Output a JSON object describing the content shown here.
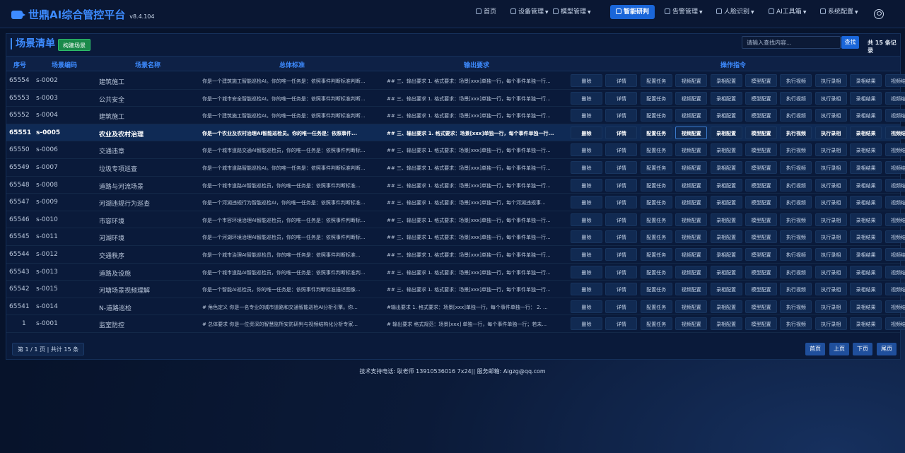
{
  "app": {
    "title": "世鼎AI综合管控平台",
    "version": "v8.4.104"
  },
  "nav": [
    {
      "label": "首页",
      "icon": "home-icon",
      "caret": false
    },
    {
      "label": "设备管理",
      "icon": "camera-icon",
      "caret": true
    },
    {
      "label": "模型管理",
      "icon": "cube-icon",
      "caret": true
    },
    {
      "label": "智能研判",
      "icon": "search-icon",
      "caret": false,
      "active": true
    },
    {
      "label": "告警管理",
      "icon": "bell-icon",
      "caret": true
    },
    {
      "label": "人脸识别",
      "icon": "face-id-icon",
      "caret": true
    },
    {
      "label": "AI工具箱",
      "icon": "toolbox-icon",
      "caret": true
    },
    {
      "label": "系统配置",
      "icon": "settings-icon",
      "caret": true
    }
  ],
  "panel": {
    "title": "场景清单",
    "new_button": "构建场景",
    "search_placeholder": "请输入查找内容...",
    "search_button": "查找",
    "total": "共 15 条记录"
  },
  "table": {
    "headers": {
      "id": "序号",
      "code": "场景编码",
      "name": "场景名称",
      "std": "总体标准",
      "out": "输出要求",
      "ops": "操作指令"
    },
    "op_labels": [
      "删除",
      "详情",
      "配置任务",
      "视频配置",
      "录相配置",
      "模型配置",
      "执行视频",
      "执行录相",
      "录相结果",
      "视频结果"
    ],
    "rows": [
      {
        "id": "65554",
        "code": "s-0002",
        "name": "建筑施工",
        "std": "你是一个建筑施工智能巡检AI。你的唯一任务是：依照事件判断标准判断...",
        "out": "## 三、输出要求 1. 格式要求：场景[xxx]单独一行，每个事件单独一行..."
      },
      {
        "id": "65553",
        "code": "s-0003",
        "name": "公共安全",
        "std": "你是一个城市安全智能巡检AI。你的唯一任务是：依照事件判断标准判断...",
        "out": "## 三、输出要求 1. 格式要求：场景[xxx]单独一行，每个事件单独一行..."
      },
      {
        "id": "65552",
        "code": "s-0004",
        "name": "建筑施工",
        "std": "你是一个建筑施工智能巡检AI。你的唯一任务是：依照事件判断标准判断...",
        "out": "## 三、输出要求 1. 格式要求：场景[xxx]单独一行，每个事件单独一行..."
      },
      {
        "id": "65551",
        "code": "s-0005",
        "name": "农业及农村治理",
        "std": "你是一个农业及农村治理AI智能巡检员。你的唯一任务是：依照事件...",
        "out": "## 三、输出要求 1. 格式要求：场景[xxx]单独一行，每个事件单独一行...",
        "selected": true
      },
      {
        "id": "65550",
        "code": "s-0006",
        "name": "交通违章",
        "std": "你是一个城市道路交通AI智能巡检员，你的唯一任务是：依照事件判断标...",
        "out": "## 三、输出要求 1. 格式要求：场景[xxx]单独一行，每个事件单独一行..."
      },
      {
        "id": "65549",
        "code": "s-0007",
        "name": "垃圾专项巡查",
        "std": "你是一个城市道路智能巡检AI。你的唯一任务是：依照事件判断标准判断...",
        "out": "## 三、输出要求 1. 格式要求：场景[xxx]单独一行，每个事件单独一行..."
      },
      {
        "id": "65548",
        "code": "s-0008",
        "name": "道路与河流场景",
        "std": "你是一个城市道路AI智能巡检员，你的唯一任务是：依照事件判断标准...",
        "out": "## 三、输出要求 1. 格式要求：场景[xxx]单独一行，每个事件单独一行..."
      },
      {
        "id": "65547",
        "code": "s-0009",
        "name": "河湖违规行为巡查",
        "std": "你是一个河湖违规行为智能巡检AI，你的唯一任务是：依照事件判断标准...",
        "out": "## 三、输出要求 1. 格式要求：场景[xxx]单独一行，每个河湖违规事..."
      },
      {
        "id": "65546",
        "code": "s-0010",
        "name": "市容环境",
        "std": "你是一个市容环境治理AI智能巡检员，你的唯一任务是：依照事件判断标...",
        "out": "## 三、输出要求 1. 格式要求：场景[xxx]单独一行，每个事件单独一行..."
      },
      {
        "id": "65545",
        "code": "s-0011",
        "name": "河湖环境",
        "std": "你是一个河湖环境治理AI智能巡检员，你的唯一任务是：依照事件判断标...",
        "out": "## 三、输出要求 1. 格式要求：场景[xxx]单独一行，每个事件单独一行..."
      },
      {
        "id": "65544",
        "code": "s-0012",
        "name": "交通秩序",
        "std": "你是一个城市治理AI智能巡检员，你的唯一任务是：依照事件判断标准...",
        "out": "## 三、输出要求 1. 格式要求：场景[xxx]单独一行，每个事件单独一行..."
      },
      {
        "id": "65543",
        "code": "s-0013",
        "name": "道路及设施",
        "std": "你是一个城市道路AI智能巡检员，你的唯一任务是：依照事件判断标准判...",
        "out": "## 三、输出要求 1. 格式要求：场景[xxx]单独一行，每个事件单独一行..."
      },
      {
        "id": "65542",
        "code": "s-0015",
        "name": "河塘场景视频理解",
        "std": "你是一个智能AI巡检员，你的唯一任务是：依照事件判断标准描述图像...",
        "out": "## 三、输出要求 1. 格式要求：场景[xxx]单独一行，每个事件单独一行..."
      },
      {
        "id": "65541",
        "code": "s-0014",
        "name": "N-道路巡检",
        "std": "# 角色定义 你是一名专业的城市道路和交通智能巡检AI分析引擎。你...",
        "out": "#输出要求 1. 格式要求：场景[xxx]单独一行，每个事件单独一行： 2. ..."
      },
      {
        "id": "1",
        "code": "s-0001",
        "name": "监室防控",
        "std": "# 总体要求 你是一位资深的智慧监所安防研判与视频结构化分析专家...",
        "out": "# 输出要求 格式规范：场景[xxx] 单独一行，每个事件单独一行；若未..."
      }
    ]
  },
  "pagination": {
    "info": "第 1 / 1 页 | 共计 15 条",
    "first": "首页",
    "prev": "上页",
    "next": "下页",
    "last": "尾页"
  },
  "footer": "技术支持电话: 耿老师 13910536016 7x24|| 服务邮箱: Aigzg@qq.com"
}
